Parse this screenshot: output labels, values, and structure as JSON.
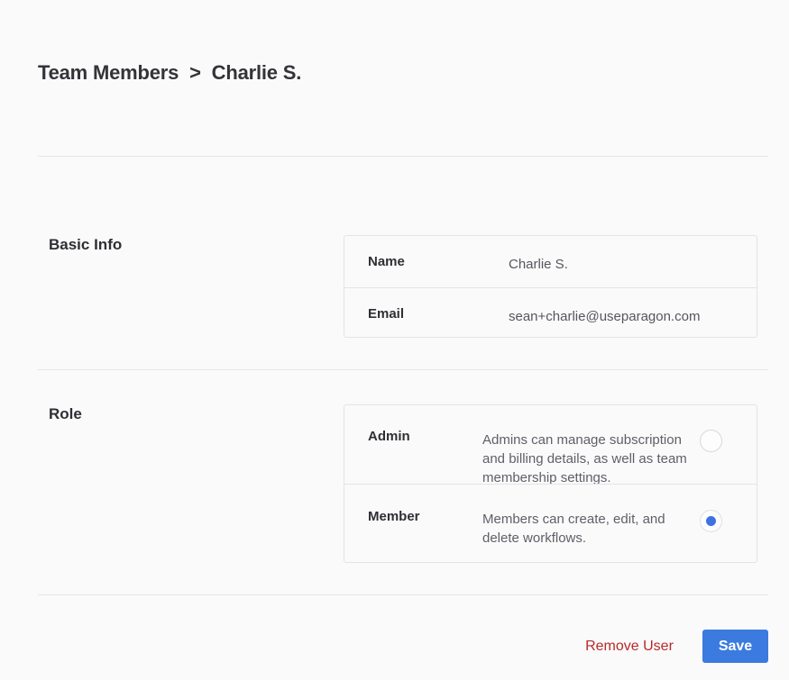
{
  "header": {
    "breadcrumb_parent": "Team Members",
    "breadcrumb_separator": ">",
    "breadcrumb_current": "Charlie S."
  },
  "basic_info": {
    "title": "Basic Info",
    "fields": [
      {
        "label": "Name",
        "value": "Charlie S."
      },
      {
        "label": "Email",
        "value": "sean+charlie@useparagon.com"
      }
    ]
  },
  "role": {
    "title": "Role",
    "selected": "Member",
    "options": [
      {
        "label": "Admin",
        "description": "Admins can manage subscription and billing details, as well as team membership settings.",
        "checked": false
      },
      {
        "label": "Member",
        "description": "Members can create, edit, and delete workflows.",
        "checked": true
      }
    ]
  },
  "actions": {
    "remove_label": "Remove User",
    "save_label": "Save"
  },
  "colors": {
    "accent": "#3b7be0",
    "danger": "#b92a2a",
    "radio_selected": "#3d72e4"
  }
}
